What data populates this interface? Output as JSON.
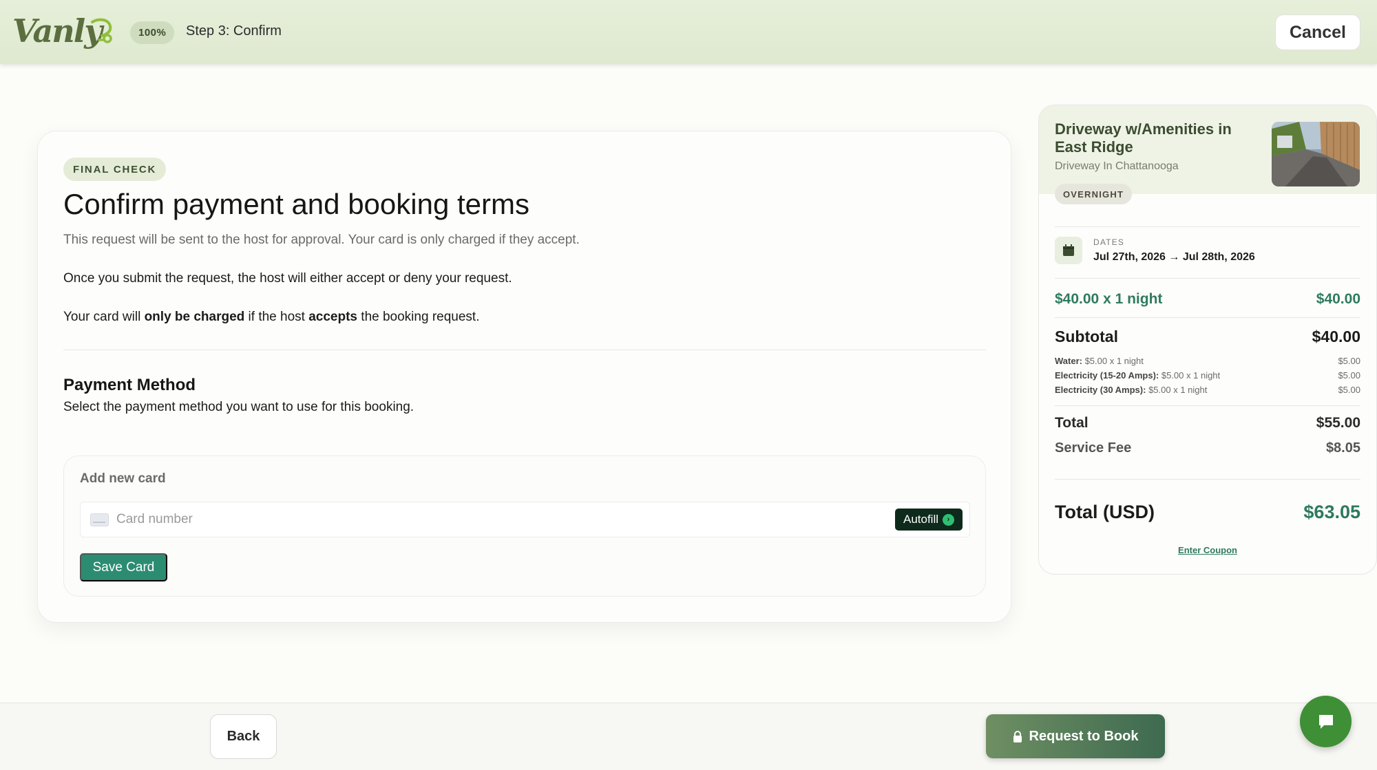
{
  "header": {
    "logo_text": "Vanly",
    "progress": "100%",
    "step_label": "Step 3: Confirm",
    "cancel_label": "Cancel"
  },
  "main": {
    "badge": "FINAL CHECK",
    "title": "Confirm payment and booking terms",
    "subtitle": "This request will be sent to the host for approval. Your card is only charged if they accept.",
    "para1": "Once you submit the request, the host will either accept or deny your request.",
    "para2": {
      "t1": "Your card will ",
      "b1": "only be charged",
      "t2": " if the host ",
      "b2": "accepts",
      "t3": " the booking request."
    },
    "payment": {
      "title": "Payment Method",
      "subtitle": "Select the payment method you want to use for this booking.",
      "add_card_label": "Add new card",
      "card_placeholder": "Card number",
      "autofill_label": "Autofill",
      "save_card_label": "Save Card"
    }
  },
  "summary": {
    "listing_title": "Driveway w/Amenities in East Ridge",
    "listing_sub": "Driveway In Chattanooga",
    "badge": "OVERNIGHT",
    "dates_label": "DATES",
    "dates_value": "Jul 27th, 2026 → Jul 28th, 2026",
    "nightly_label": "$40.00 x 1 night",
    "nightly_value": "$40.00",
    "subtotal_label": "Subtotal",
    "subtotal_value": "$40.00",
    "fees": [
      {
        "name": "Water:",
        "detail": " $5.00 x 1 night",
        "value": "$5.00"
      },
      {
        "name": "Electricity (15-20 Amps):",
        "detail": " $5.00 x 1 night",
        "value": "$5.00"
      },
      {
        "name": "Electricity (30 Amps):",
        "detail": " $5.00 x 1 night",
        "value": "$5.00"
      }
    ],
    "total_label": "Total",
    "total_value": "$55.00",
    "service_label": "Service Fee",
    "service_value": "$8.05",
    "grand_label": "Total (USD)",
    "grand_value": "$63.05",
    "coupon_label": "Enter Coupon"
  },
  "footer": {
    "back_label": "Back",
    "request_label": "Request to Book"
  },
  "colors": {
    "accent": "#2e7a5f",
    "header_bg": "#e6efd9",
    "save_button": "#2c8c72",
    "chat_button": "#3f8f36"
  },
  "icons": {
    "logo": "van-logo-icon",
    "card": "credit-card-icon",
    "autofill": "arrow-right-circle-icon",
    "calendar": "calendar-icon",
    "lock": "lock-icon",
    "chat": "chat-bubble-icon"
  }
}
